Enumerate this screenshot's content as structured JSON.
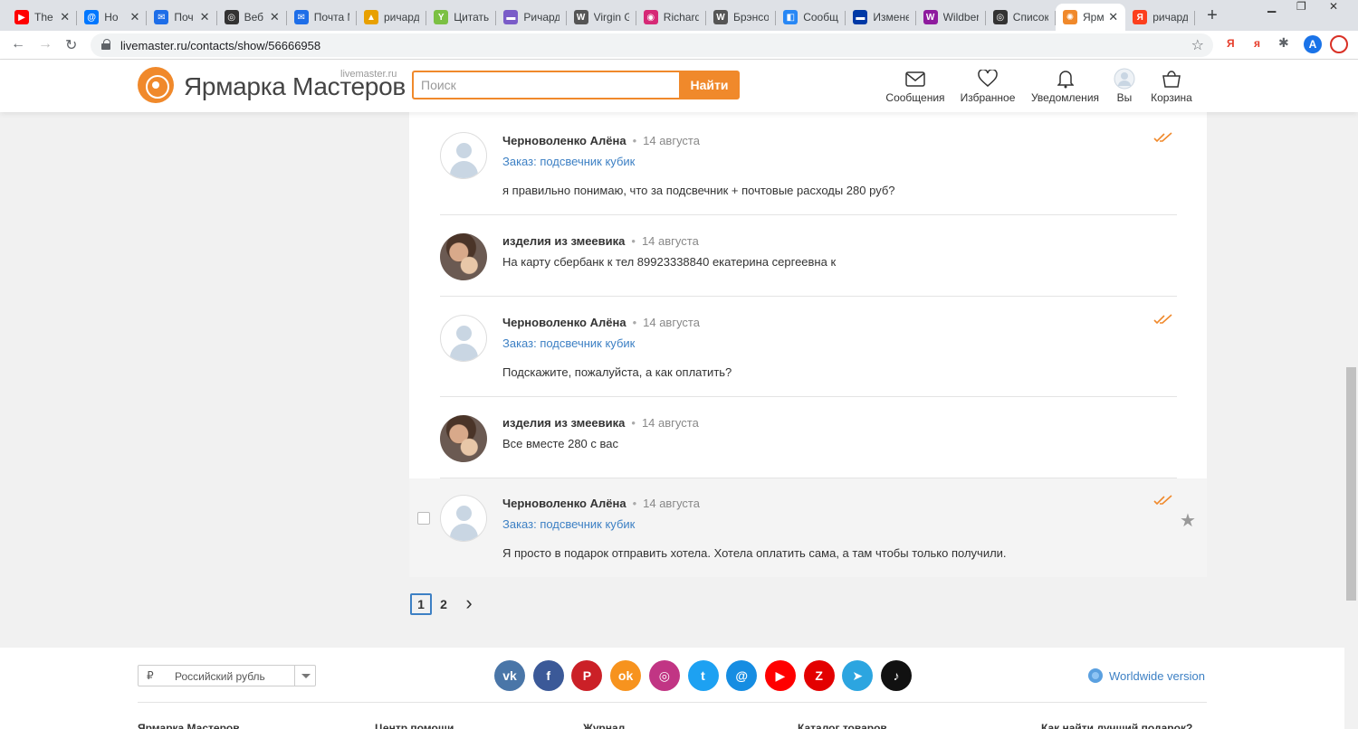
{
  "browser": {
    "tabs": [
      {
        "title": "The",
        "color": "#ff0000",
        "glyph": "▶"
      },
      {
        "title": "Ho",
        "color": "#0077ff",
        "glyph": "@"
      },
      {
        "title": "Поч",
        "color": "#1e6ee8",
        "glyph": "✉"
      },
      {
        "title": "Веб",
        "color": "#333333",
        "glyph": "◎"
      },
      {
        "title": "Почта M",
        "color": "#1e6ee8",
        "glyph": "✉"
      },
      {
        "title": "ричард",
        "color": "#e8a000",
        "glyph": "▲"
      },
      {
        "title": "Цитаты",
        "color": "#7bc043",
        "glyph": "Y"
      },
      {
        "title": "Ричард",
        "color": "#7a5cc8",
        "glyph": "▬"
      },
      {
        "title": "Virgin G",
        "color": "#555555",
        "glyph": "W"
      },
      {
        "title": "Richard",
        "color": "#d62976",
        "glyph": "◉"
      },
      {
        "title": "Брэнсо",
        "color": "#555555",
        "glyph": "W"
      },
      {
        "title": "Сообщ",
        "color": "#2787f5",
        "glyph": "◧"
      },
      {
        "title": "Измене",
        "color": "#0039a6",
        "glyph": "▬"
      },
      {
        "title": "Wildber",
        "color": "#8e1b9e",
        "glyph": "W"
      },
      {
        "title": "Список",
        "color": "#333333",
        "glyph": "◎"
      },
      {
        "title": "Ярм",
        "color": "#f0892b",
        "glyph": "✺"
      },
      {
        "title": "ричард",
        "color": "#fc3f1d",
        "glyph": "Я"
      }
    ],
    "active_tab_index": 15,
    "url": "livemaster.ru/contacts/show/56666958",
    "new_tab": "+",
    "extensions": [
      "Я",
      "я",
      "A"
    ]
  },
  "header": {
    "logo_text": "Ярмарка Мастеров",
    "logo_domain": "livemaster.ru",
    "search_placeholder": "Поиск",
    "search_button": "Найти",
    "nav": [
      {
        "label": "Сообщения",
        "icon": "envelope-icon"
      },
      {
        "label": "Избранное",
        "icon": "heart-icon"
      },
      {
        "label": "Уведомления",
        "icon": "bell-icon"
      },
      {
        "label": "Вы",
        "icon": "user-icon"
      },
      {
        "label": "Корзина",
        "icon": "cart-icon"
      }
    ]
  },
  "messages": [
    {
      "author": "Черноволенко Алёна",
      "date": "14 августа",
      "order": "Заказ: подсвечник кубик",
      "text": "я правильно понимаю, что за подсвечник + почтовые расходы 280 руб?",
      "avatar": "default",
      "read_ticks": true
    },
    {
      "author": "изделия из змеевика",
      "date": "14 августа",
      "order": "",
      "text": "На карту сбербанк к тел 89923338840 екатерина сергеевна к",
      "avatar": "photo",
      "read_ticks": false
    },
    {
      "author": "Черноволенко Алёна",
      "date": "14 августа",
      "order": "Заказ: подсвечник кубик",
      "text": "Подскажите, пожалуйста, а как оплатить?",
      "avatar": "default",
      "read_ticks": true
    },
    {
      "author": "изделия из змеевика",
      "date": "14 августа",
      "order": "",
      "text": "Все вместе 280 с вас",
      "avatar": "photo",
      "read_ticks": false
    },
    {
      "author": "Черноволенко Алёна",
      "date": "14 августа",
      "order": "Заказ: подсвечник кубик",
      "text": "Я просто в подарок отправить хотела. Хотела оплатить сама, а там чтобы только получили.",
      "avatar": "default",
      "read_ticks": true,
      "highlighted": true
    }
  ],
  "pagination": {
    "pages": [
      "1",
      "2"
    ],
    "current": "1",
    "next": "›"
  },
  "footer": {
    "currency_symbol": "₽",
    "currency": "Российский рубль",
    "social": [
      {
        "name": "vk-icon",
        "glyph": "vk",
        "color": "#4a76a8"
      },
      {
        "name": "facebook-icon",
        "glyph": "f",
        "color": "#3b5998"
      },
      {
        "name": "pinterest-icon",
        "glyph": "P",
        "color": "#cb2027"
      },
      {
        "name": "odnoklassniki-icon",
        "glyph": "ok",
        "color": "#f7931e"
      },
      {
        "name": "instagram-icon",
        "glyph": "◎",
        "color": "#c13584"
      },
      {
        "name": "twitter-icon",
        "glyph": "t",
        "color": "#1da1f2"
      },
      {
        "name": "mailru-icon",
        "glyph": "@",
        "color": "#168de2"
      },
      {
        "name": "youtube-icon",
        "glyph": "▶",
        "color": "#ff0000"
      },
      {
        "name": "zen-icon",
        "glyph": "Z",
        "color": "#e30000"
      },
      {
        "name": "telegram-icon",
        "glyph": "➤",
        "color": "#2ca5e0"
      },
      {
        "name": "tiktok-icon",
        "glyph": "♪",
        "color": "#111111"
      }
    ],
    "worldwide": "Worldwide version",
    "columns": [
      "Ярмарка Мастеров",
      "Центр помощи",
      "Журнал",
      "Каталог товаров",
      "Как найти лучший подарок?"
    ]
  },
  "colors": {
    "accent": "#f0892b",
    "link": "#3d80c4"
  }
}
